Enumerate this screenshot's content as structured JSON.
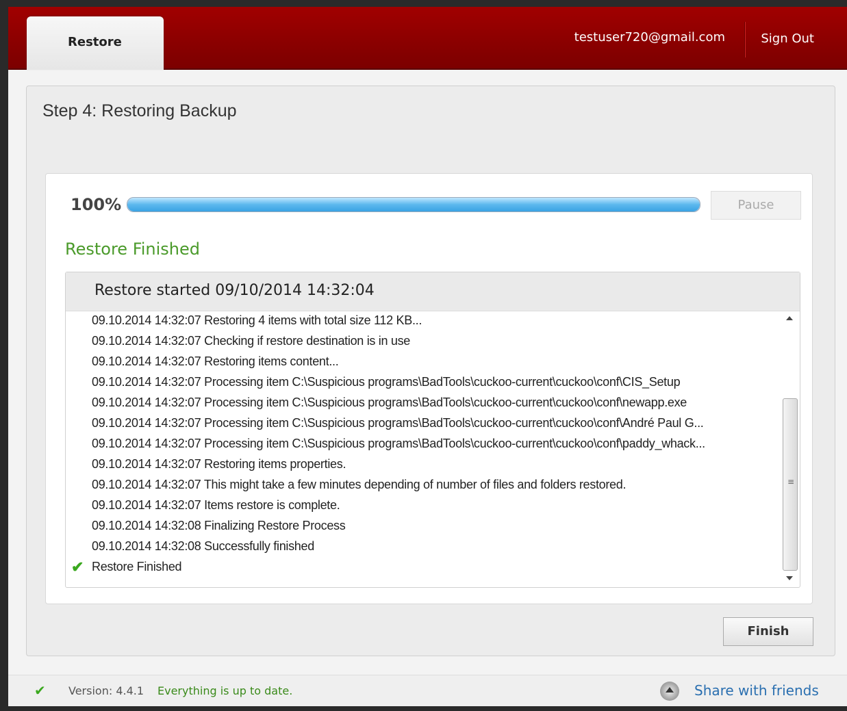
{
  "header": {
    "tab_label": "Restore",
    "email": "testuser720@gmail.com",
    "signout": "Sign Out"
  },
  "main": {
    "step_title": "Step 4: Restoring Backup",
    "progress_label": "100%",
    "progress_fraction": 1.0,
    "pause_label": "Pause",
    "status": "Restore Finished",
    "log_header": "Restore started 09/10/2014 14:32:04",
    "log_lines": [
      "09.10.2014 14:32:07 Restoring 4 items with total size 112 KB...",
      "09.10.2014 14:32:07 Checking if restore destination is in use",
      "09.10.2014 14:32:07 Restoring items content...",
      "09.10.2014 14:32:07 Processing item C:\\Suspicious programs\\BadTools\\cuckoo-current\\cuckoo\\conf\\CIS_Setup",
      "09.10.2014 14:32:07 Processing item C:\\Suspicious programs\\BadTools\\cuckoo-current\\cuckoo\\conf\\newapp.exe",
      "09.10.2014 14:32:07 Processing item C:\\Suspicious programs\\BadTools\\cuckoo-current\\cuckoo\\conf\\André Paul G...",
      "09.10.2014 14:32:07 Processing item C:\\Suspicious programs\\BadTools\\cuckoo-current\\cuckoo\\conf\\paddy_whack...",
      "09.10.2014 14:32:07 Restoring items properties.",
      "09.10.2014 14:32:07 This might take a few minutes depending of number of files and folders restored.",
      "09.10.2014 14:32:07 Items restore is complete.",
      "09.10.2014 14:32:08 Finalizing Restore Process",
      "09.10.2014 14:32:08 Successfully finished"
    ],
    "log_final": "Restore Finished",
    "finish_label": "Finish"
  },
  "footer": {
    "version": "Version: 4.4.1",
    "uptodate": "Everything is up to date.",
    "share": "Share with friends"
  },
  "colors": {
    "brand_red": "#8a0000",
    "status_green": "#4a9a2a",
    "link_blue": "#2a6fb0"
  },
  "icons": [
    "checkmark-icon",
    "share-icon",
    "scroll-up-icon",
    "scroll-down-icon"
  ]
}
